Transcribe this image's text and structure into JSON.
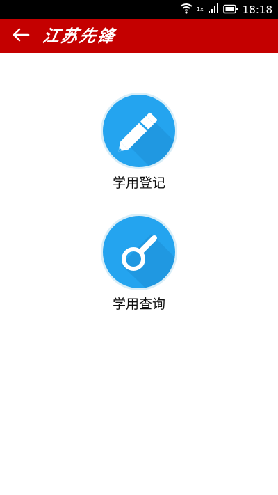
{
  "status_bar": {
    "time": "18:18",
    "network_label": "1x",
    "icons": [
      "wifi-icon",
      "signal-icon",
      "battery-icon"
    ]
  },
  "app_bar": {
    "brand": "江苏先锋",
    "back_icon": "arrow-left-icon",
    "background_color": "#c40000"
  },
  "menu": [
    {
      "label": "学用登记",
      "icon": "pencil-icon"
    },
    {
      "label": "学用查询",
      "icon": "magnifier-icon"
    }
  ],
  "colors": {
    "accent": "#24a4ef",
    "ring": "#d9eef8"
  }
}
